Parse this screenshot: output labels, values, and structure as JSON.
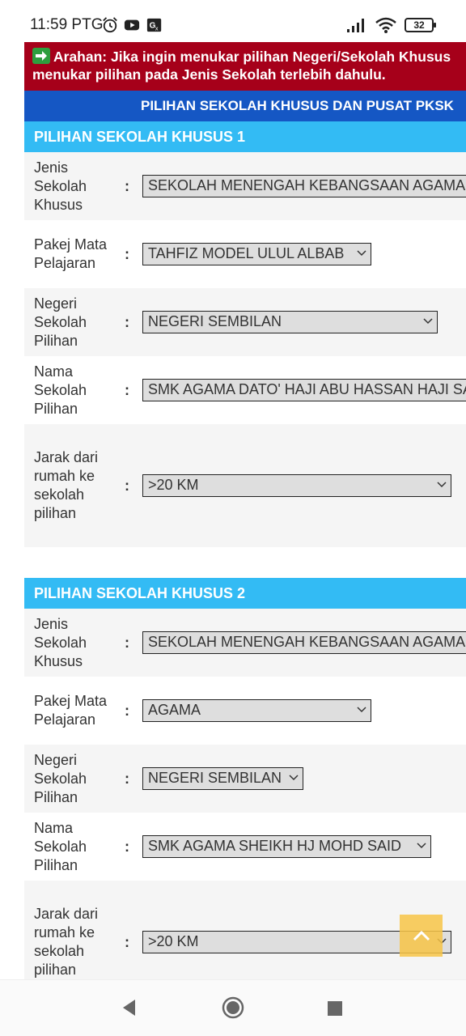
{
  "status_bar": {
    "time": "11:59 PTG",
    "icons": [
      "alarm-icon",
      "youtube-icon",
      "translate-icon"
    ],
    "battery": "32",
    "right_icons": [
      "signal-icon",
      "wifi-icon",
      "battery-icon"
    ]
  },
  "banner": {
    "line1": "Arahan: Jika ingin menukar pilihan Negeri/Sekolah Khusus",
    "line2": "menukar pilihan pada Jenis Sekolah terlebih dahulu.",
    "bg_color": "#a6001a"
  },
  "main_title": "PILIHAN SEKOLAH KHUSUS DAN PUSAT PKSK",
  "separator": ":",
  "sections": [
    {
      "title": "PILIHAN SEKOLAH KHUSUS 1",
      "fields": [
        {
          "label": "Jenis Sekolah Khusus",
          "value": "SEKOLAH MENENGAH KEBANGSAAN AGAMA"
        },
        {
          "label": "Pakej Mata Pelajaran",
          "value": "TAHFIZ MODEL ULUL ALBAB"
        },
        {
          "label": "Negeri Sekolah Pilihan",
          "value": "NEGERI SEMBILAN"
        },
        {
          "label": "Nama Sekolah Pilihan",
          "value": "SMK AGAMA DATO' HAJI ABU HASSAN HAJI SAIL"
        },
        {
          "label": "Jarak dari rumah ke sekolah pilihan",
          "value": ">20 KM"
        }
      ]
    },
    {
      "title": "PILIHAN SEKOLAH KHUSUS 2",
      "fields": [
        {
          "label": "Jenis Sekolah Khusus",
          "value": "SEKOLAH MENENGAH KEBANGSAAN AGAMA"
        },
        {
          "label": "Pakej Mata Pelajaran",
          "value": "AGAMA"
        },
        {
          "label": "Negeri Sekolah Pilihan",
          "value": "NEGERI SEMBILAN"
        },
        {
          "label": "Nama Sekolah Pilihan",
          "value": "SMK AGAMA SHEIKH HJ MOHD SAID"
        },
        {
          "label": "Jarak dari rumah ke sekolah pilihan",
          "value": ">20 KM"
        }
      ]
    }
  ],
  "colors": {
    "section_header": "#33bbf4",
    "main_title_bg": "#1557c4",
    "scroll_top_button": "#f7c446"
  }
}
